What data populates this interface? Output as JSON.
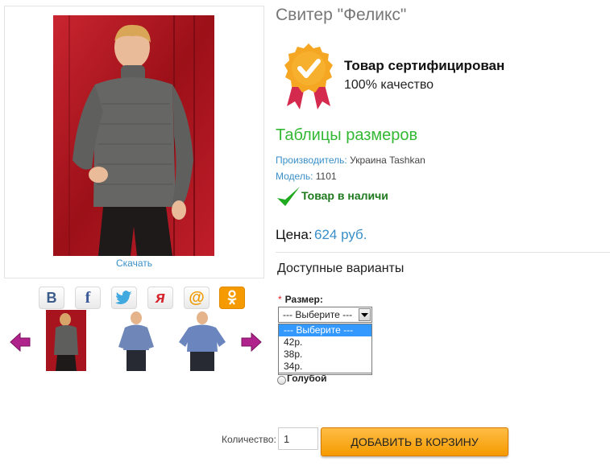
{
  "product": {
    "title": "Свитер \"Феликс\"",
    "download_link": "Скачать"
  },
  "share": {
    "icons": [
      "vk-icon",
      "facebook-icon",
      "twitter-icon",
      "odnoklassniki-y-icon",
      "mail-ru-icon",
      "ok-icon"
    ],
    "vk_glyph": "B",
    "fb_glyph": "f",
    "ya_glyph": "я",
    "mail_glyph": "@"
  },
  "certificate": {
    "title": "Товар сертифицирован",
    "subtitle": "100% качество"
  },
  "size_table_link": "Таблицы размеров",
  "meta": {
    "manufacturer_label": "Производитель:",
    "manufacturer_value": "Украина Tashkan",
    "model_label": "Модель:",
    "model_value": "1101"
  },
  "stock": "Товар в наличи",
  "price": {
    "label": "Цена:",
    "value": "624 руб."
  },
  "options": {
    "title": "Доступные варианты",
    "size_required_mark": "*",
    "size_label": "Размер:",
    "size_selected": "--- Выберите ---",
    "size_options": [
      "--- Выберите ---",
      "42р.",
      "38р.",
      "34р."
    ],
    "color_label": "Голубой"
  },
  "cart": {
    "quantity_label": "Количество:",
    "quantity_value": "1",
    "add_button": "ДОБАВИТЬ В КОРЗИНУ"
  },
  "colors": {
    "link_blue": "#3a8fc8",
    "green": "#33b833",
    "stock_green": "#1f7a1f",
    "button_orange": "#f59a00"
  }
}
